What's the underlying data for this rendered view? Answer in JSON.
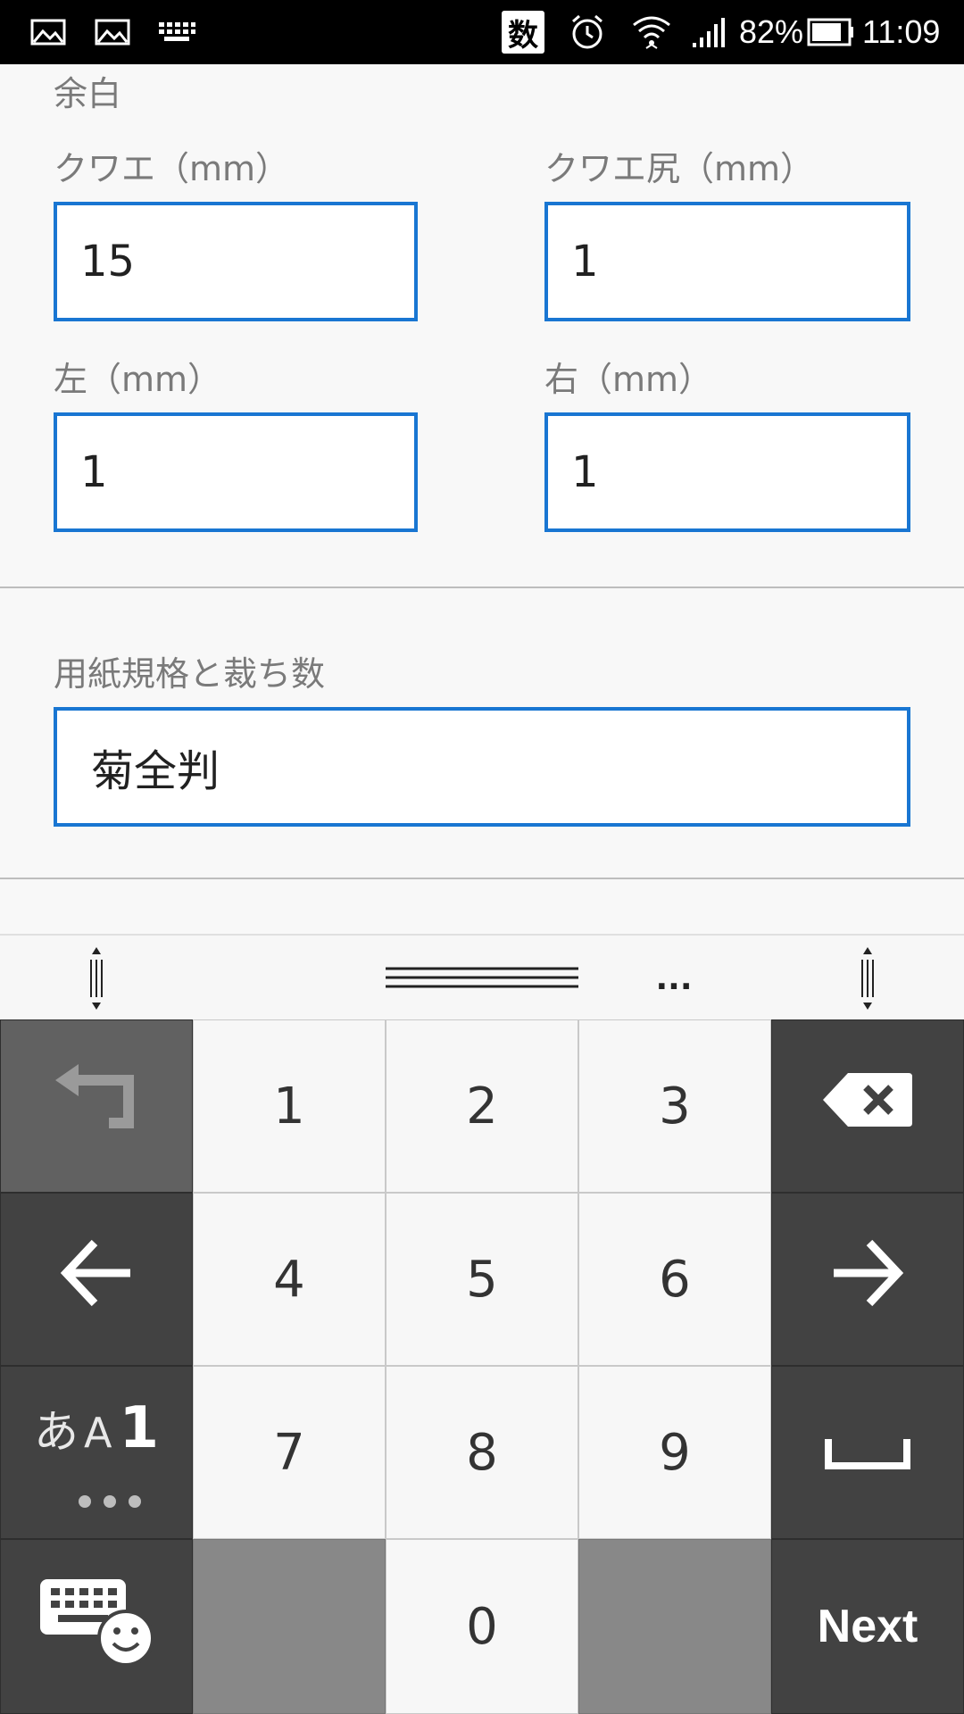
{
  "status_bar": {
    "ime_indicator": "数",
    "battery_percent": "82%",
    "time": "11:09",
    "icons": [
      "image-icon",
      "image-icon",
      "keyboard-icon",
      "alarm-icon",
      "wifi-icon",
      "signal-icon",
      "battery-icon"
    ]
  },
  "form": {
    "margin_section_title": "余白",
    "fields": {
      "gripper": {
        "label": "クワエ（mm）",
        "value": "15"
      },
      "tail": {
        "label": "クワエ尻（mm）",
        "value": "1"
      },
      "left": {
        "label": "左（mm）",
        "value": "1"
      },
      "right": {
        "label": "右（mm）",
        "value": "1"
      }
    },
    "paper": {
      "label": "用紙規格と裁ち数",
      "value": "菊全判"
    }
  },
  "keyboard": {
    "toolbar": {
      "more": "..."
    },
    "keys": {
      "k1": "1",
      "k2": "2",
      "k3": "3",
      "k4": "4",
      "k5": "5",
      "k6": "6",
      "k7": "7",
      "k8": "8",
      "k9": "9",
      "k0": "0",
      "mode_kana": "あ",
      "mode_alpha": "A",
      "mode_num": "1",
      "next": "Next"
    },
    "colors": {
      "dark_key": "#424242",
      "light_key": "#f7f7f7",
      "accent_border": "#1976d2"
    }
  }
}
